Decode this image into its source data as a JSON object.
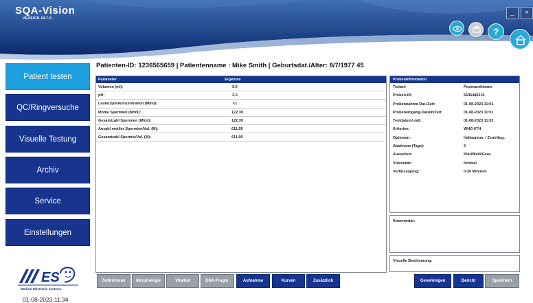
{
  "app": {
    "name": "SQA-Vision",
    "version": "VERSION 44.7.0"
  },
  "colors": {
    "primary": "#17358f",
    "active": "#1da0dd",
    "inactive_button": "#9aa0a8"
  },
  "header": {
    "icons": [
      "eye-icon",
      "print-icon",
      "help-icon",
      "home-icon",
      "minimize-icon",
      "close-icon"
    ],
    "minimize": "_",
    "close": "×",
    "help": "?"
  },
  "sidebar": {
    "items": [
      {
        "label": "Patient testen",
        "active": true
      },
      {
        "label": "QC/Ringversuche",
        "active": false
      },
      {
        "label": "Visuelle Testung",
        "active": false
      },
      {
        "label": "Archiv",
        "active": false
      },
      {
        "label": "Service",
        "active": false
      },
      {
        "label": "Einstellungen",
        "active": false
      }
    ],
    "logo_text": "Medical Electronic Systems",
    "timestamp": "01-08-2023 11:34"
  },
  "patient": {
    "line": "Patienten-ID: 1236565659 | Patientenname : Mike Smith | Geburtsdat./Alter: 8/7/1977 45"
  },
  "results": {
    "headers": {
      "parameter": "Parameter",
      "result": "Ergebnis"
    },
    "rows": [
      {
        "parameter": "Volumen (ml):",
        "value": "5.0"
      },
      {
        "parameter": "pH:",
        "value": "2.0"
      },
      {
        "parameter": "Leukozytenkonzentration (M/ml):",
        "value": "<1"
      },
      {
        "parameter": "Motile Spermien (M/ml):",
        "value": "122.39"
      },
      {
        "parameter": "Gesamtzahl Spermien (M/ml):",
        "value": "122.39"
      },
      {
        "parameter": "Anzahl motiler Spermien/Vol. (M):",
        "value": "611.95"
      },
      {
        "parameter": "Gesamtzahl Spermie/Vol. (M):",
        "value": "611.95"
      }
    ]
  },
  "sample_info": {
    "title": "Probeninformation",
    "rows": [
      {
        "key": "Testart:",
        "value": "Postvasektomie"
      },
      {
        "key": "Proben-ID:",
        "value": "5645486216"
      },
      {
        "key": "Probennahme Dat./Zeit:",
        "value": "01-08-2023 11:01"
      },
      {
        "key": "Probeneingang-Datum/Zeit:",
        "value": "01-08-2023 11:01"
      },
      {
        "key": "Testdatum/-zeit:",
        "value": "01-08-2023 11:02"
      },
      {
        "key": "Kriterien:",
        "value": "WHO 6TH"
      },
      {
        "key": "Optionen:",
        "value": "Halbautom. / Zentrifug."
      },
      {
        "key": "Abstinenz (Tage):",
        "value": "3"
      },
      {
        "key": "Aussehen:",
        "value": "Klar/Weiß/Grau"
      },
      {
        "key": "Viskosität:",
        "value": "Normal"
      },
      {
        "key": "Verflüssigung:",
        "value": "0-30 Minuten"
      }
    ]
  },
  "comment_label": "Kommentar:",
  "visual_label": "Visuelle Bestimmung:",
  "bottom_buttons": {
    "left": [
      {
        "label": "Zelltrümmer",
        "enabled": false
      },
      {
        "label": "Morphologie",
        "enabled": false
      },
      {
        "label": "Vitalität",
        "enabled": false
      },
      {
        "label": "DNA-Fragm.",
        "enabled": false
      },
      {
        "label": "Aufnahme",
        "enabled": true
      },
      {
        "label": "Kurven",
        "enabled": true
      },
      {
        "label": "Zusätzlich",
        "enabled": true
      }
    ],
    "right": [
      {
        "label": "Genehmigen",
        "enabled": true
      },
      {
        "label": "Bericht",
        "enabled": true
      },
      {
        "label": "Speichern",
        "enabled": false
      }
    ]
  }
}
